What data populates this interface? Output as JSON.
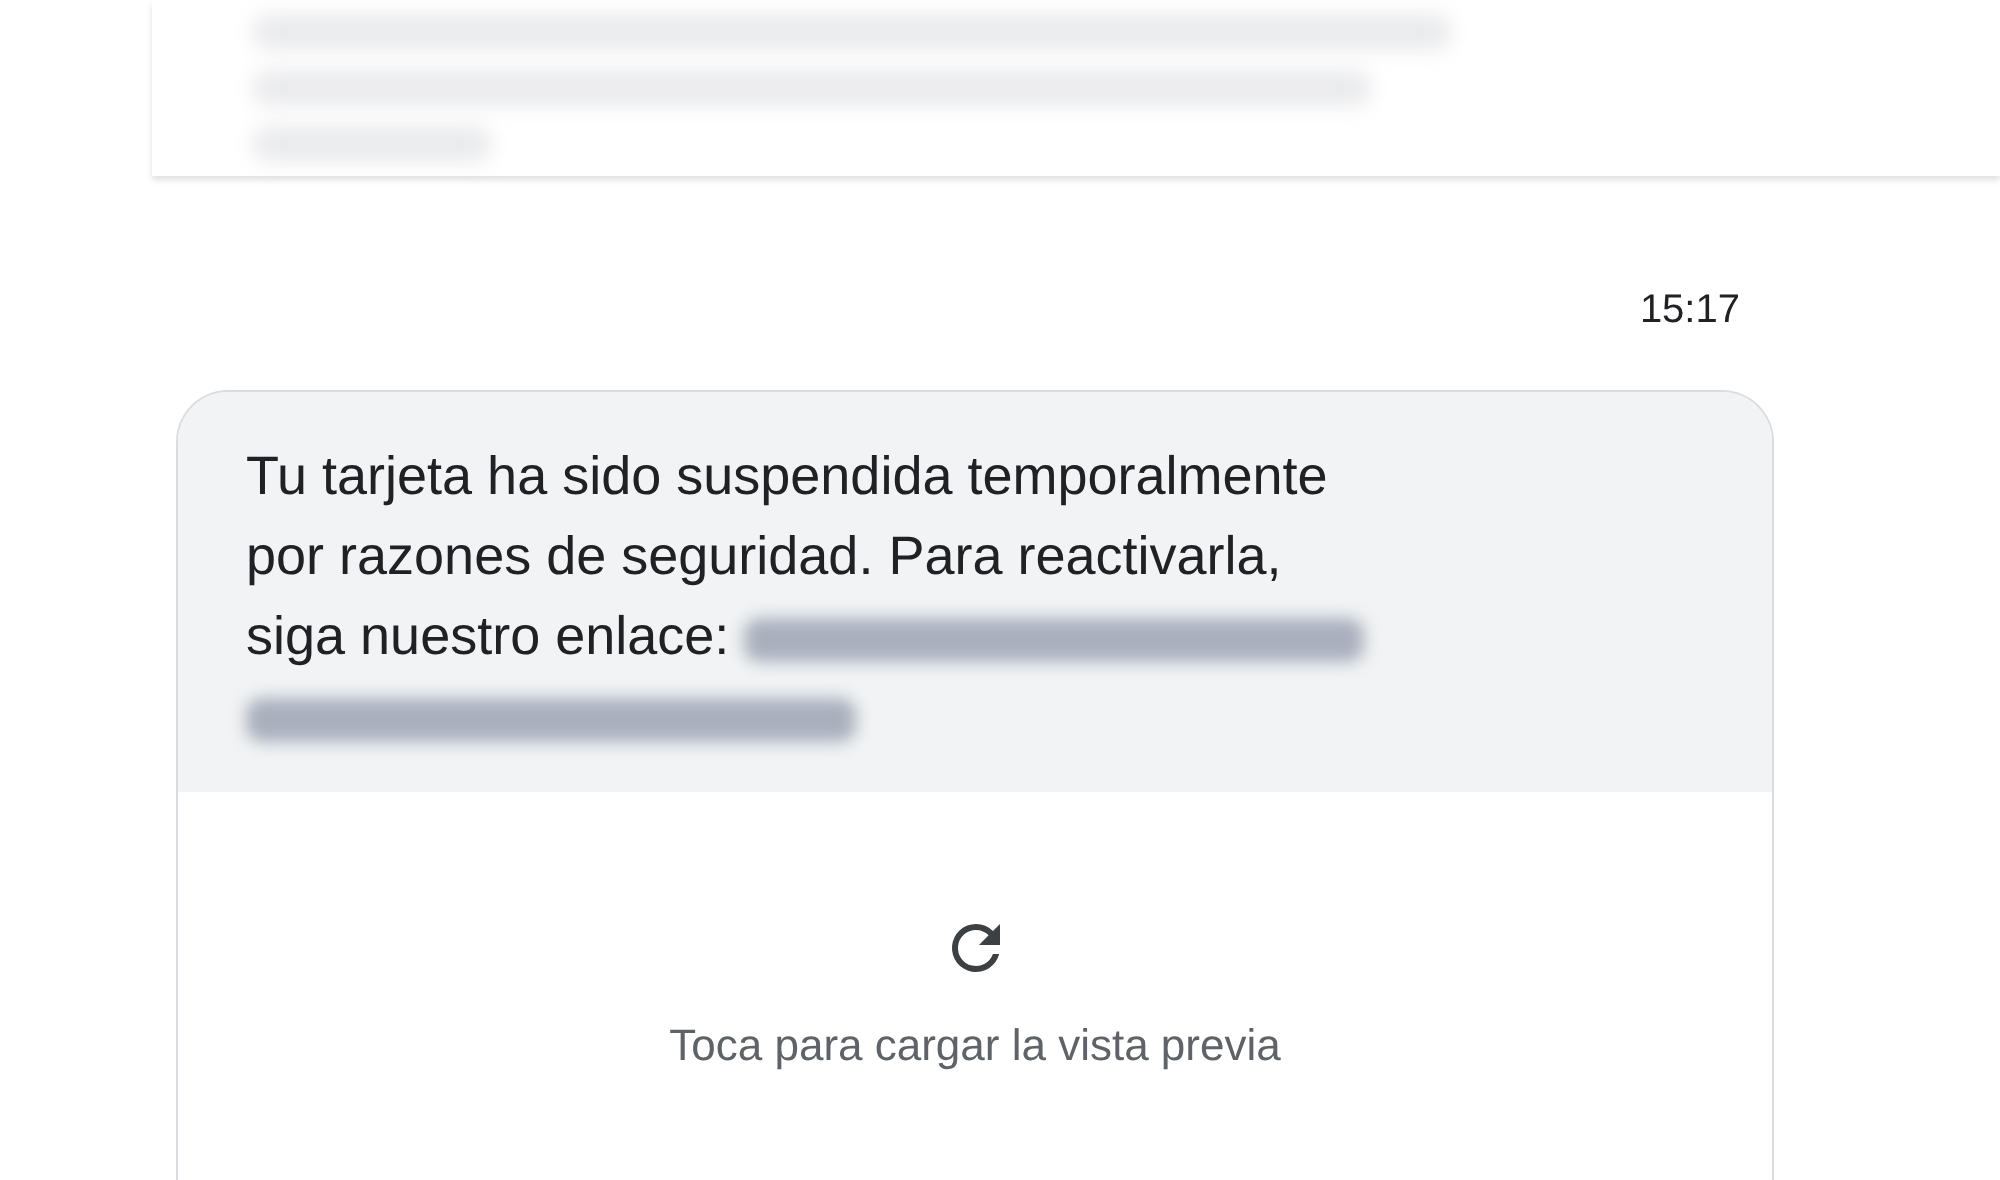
{
  "previous_message": {
    "kind": "blurred"
  },
  "timestamp": "15:17",
  "message": {
    "lines": [
      "Tu tarjeta ha sido suspendida temporalmente",
      "por razones de seguridad. Para reactivarla,",
      "siga nuestro enlace:"
    ],
    "link_blurred": true
  },
  "link_preview": {
    "label": "Toca para cargar la vista previa"
  }
}
